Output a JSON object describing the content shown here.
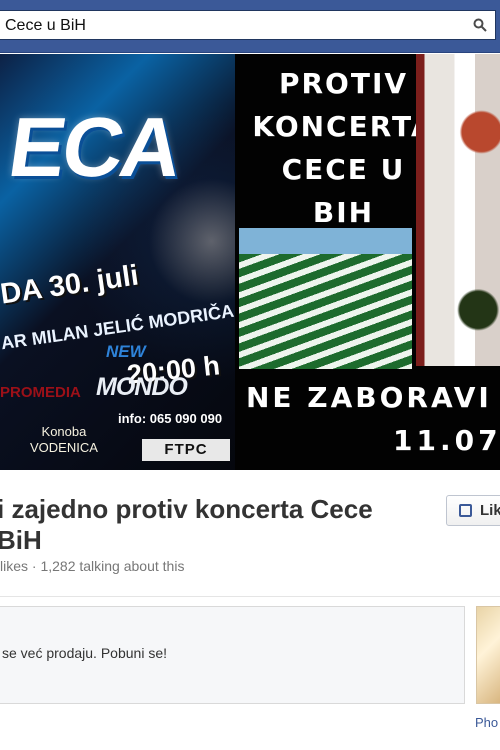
{
  "search": {
    "value": "Cece u BiH"
  },
  "cover": {
    "left_poster": {
      "main_title": "ECA",
      "date": "DA 30. juli",
      "venue": "AR MILAN JELIĆ MODRIČA",
      "time": "20:00 h",
      "logo_prefix": "NEW",
      "logo_name": "MONDO",
      "logo_subtitle": "MODRIČA",
      "info": "info: 065 090 090",
      "sponsor_one": "PROMEDIA",
      "sponsor_two": "Konoba\nVODENICA",
      "sponsor_three": "FTPC"
    },
    "right_panel": {
      "headline_lines": [
        "PROTIV",
        "KONCERTA",
        "CECE U",
        "BIH"
      ],
      "bottom_text": "NE ZABORAVI",
      "bottom_date": "11.07"
    }
  },
  "page": {
    "title_line_one": "i zajedno protiv koncerta Cece",
    "title_line_two": "BiH",
    "stats": "likes · 1,282 talking about this",
    "like_button": "Lik"
  },
  "post": {
    "text": "se već prodaju. Pobuni se!"
  },
  "side": {
    "photos_link": "Pho"
  },
  "colors": {
    "facebook_blue": "#3b5998",
    "dark_background": "#05070d",
    "text_gray": "#777777"
  }
}
